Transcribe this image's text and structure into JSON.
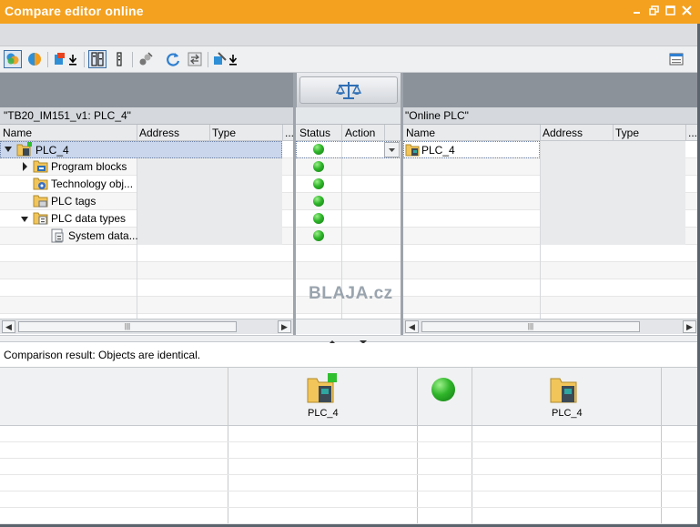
{
  "window": {
    "title": "Compare editor online"
  },
  "toolbar": {
    "buttons": [
      {
        "icon": "show-all-objects-icon"
      },
      {
        "icon": "show-differences-icon"
      },
      {
        "icon": "synchronize-download-icon"
      },
      {
        "icon": "detailed-comparison-icon"
      },
      {
        "icon": "show-columns-icon"
      },
      {
        "icon": "properties-compare-icon"
      },
      {
        "icon": "refresh-icon"
      },
      {
        "icon": "swap-sides-icon"
      },
      {
        "icon": "execute-actions-icon"
      },
      {
        "icon": "split-editor-icon"
      }
    ]
  },
  "compare_icon": "balance-scale-icon",
  "left": {
    "label": "\"TB20_IM151_v1: PLC_4\"",
    "columns": [
      "Name",
      "Address",
      "Type",
      "..."
    ],
    "rows": [
      {
        "name": "PLC_4",
        "icon": "plc-device-icon",
        "expanded": true,
        "level": 0
      },
      {
        "name": "Program blocks",
        "icon": "program-blocks-folder-icon",
        "expanded": false,
        "level": 1
      },
      {
        "name": "Technology obj...",
        "icon": "technology-objects-folder-icon",
        "level": 1
      },
      {
        "name": "PLC tags",
        "icon": "plc-tags-folder-icon",
        "level": 1
      },
      {
        "name": "PLC data types",
        "icon": "plc-data-types-folder-icon",
        "expanded": true,
        "level": 1
      },
      {
        "name": "System data...",
        "icon": "system-data-icon",
        "level": 2
      }
    ]
  },
  "center": {
    "columns": [
      "Status",
      "Action"
    ],
    "status_count": 6
  },
  "right": {
    "label": "\"Online PLC\"",
    "columns": [
      "Name",
      "Address",
      "Type",
      "..."
    ],
    "rows": [
      {
        "name": "PLC_4",
        "icon": "online-plc-icon"
      }
    ]
  },
  "watermark": "BLAJA.cz",
  "comparison": {
    "result": "Comparison result: Objects are identical.",
    "left_name": "PLC_4",
    "right_name": "PLC_4"
  },
  "colors": {
    "title_bar": "#f4a11f",
    "status_ok": "#2fb52a",
    "selection": "#c9d6ec"
  }
}
